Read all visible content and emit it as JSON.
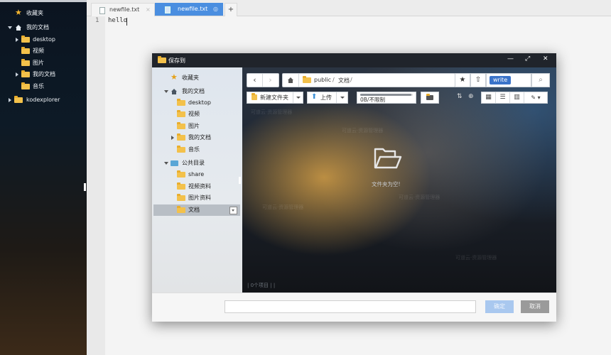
{
  "left_tree": {
    "favorites": "收藏夹",
    "my_documents": "我的文档",
    "items": [
      "desktop",
      "视频",
      "图片",
      "我的文档",
      "音乐"
    ],
    "kodexplorer": "kodexplorer"
  },
  "editor": {
    "tabs": [
      {
        "label": "newfile.txt",
        "close": "×"
      },
      {
        "label": "newfile.txt",
        "close": "◎"
      }
    ],
    "add_tab": "+",
    "line_number": "1",
    "content": "hello"
  },
  "dialog": {
    "title": "保存到",
    "controls": {
      "minimize": "—",
      "maximize": "⤢",
      "close": "✕"
    },
    "sidebar": {
      "favorites": "收藏夹",
      "my_documents": "我的文档",
      "my_items": [
        "desktop",
        "视频",
        "图片",
        "我的文档",
        "音乐"
      ],
      "public_dir": "公共目录",
      "public_items": [
        "share",
        "视频资料",
        "图片资料",
        "文档"
      ]
    },
    "toolbar": {
      "path_parts": [
        "public",
        "/",
        "文档",
        "/"
      ],
      "write_badge": "write",
      "new_folder": "新建文件夹",
      "upload": "上传",
      "quota": "0B/不限制",
      "quota_used_fraction": 0.97
    },
    "empty_message": "文件夹为空!",
    "status_left": "| 0个项目 |   |",
    "footer": {
      "filename_value": "",
      "confirm": "确定",
      "cancel": "取消"
    },
    "watermark": "可道云·资源管理器"
  },
  "colors": {
    "accent": "#4a8ee0",
    "write_badge": "#3a73c9",
    "folder": "#f3c14b",
    "confirm_button": "#a9c8ef",
    "cancel_button": "#9a9a9a"
  }
}
